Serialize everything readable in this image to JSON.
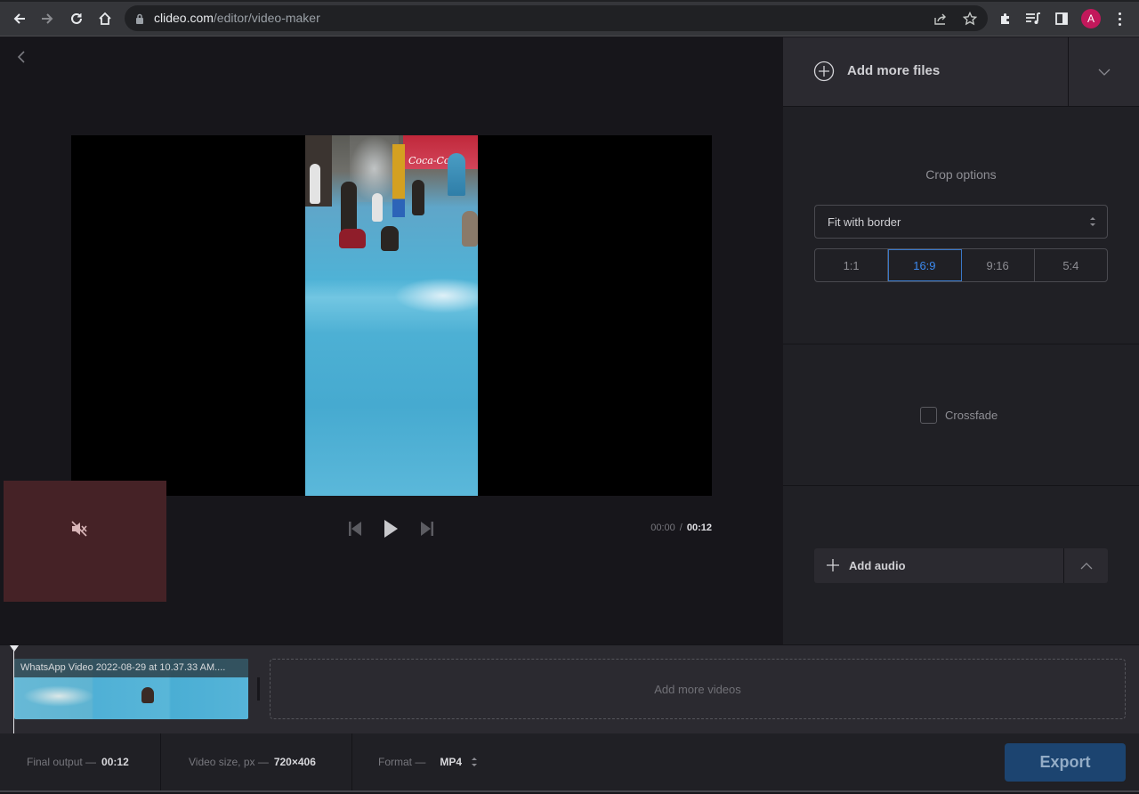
{
  "browser": {
    "url_host": "clideo.com",
    "url_path": "/editor/video-maker",
    "avatar_initial": "A",
    "icons": [
      "back-arrow-icon",
      "forward-arrow-icon",
      "reload-icon",
      "home-icon",
      "lock-icon",
      "share-icon",
      "star-icon",
      "extensions-icon",
      "media-control-icon",
      "side-panel-icon",
      "profile-avatar",
      "kebab-menu-icon"
    ]
  },
  "editor": {
    "back_icon": "chevron-left-icon",
    "player": {
      "current_time": "00:00",
      "separator": "/",
      "total_time": "00:12",
      "muted": true
    }
  },
  "side_panel": {
    "add_files_label": "Add more files",
    "crop": {
      "title": "Crop options",
      "mode": "Fit with border",
      "ratios": [
        {
          "label": "1:1",
          "active": false
        },
        {
          "label": "16:9",
          "active": true
        },
        {
          "label": "9:16",
          "active": false
        },
        {
          "label": "5:4",
          "active": false
        }
      ]
    },
    "crossfade": {
      "label": "Crossfade",
      "checked": false
    },
    "audio": {
      "label": "Add audio"
    }
  },
  "timeline": {
    "clip_title": "WhatsApp Video 2022-08-29 at 10.37.33 AM....",
    "dropzone_label": "Add more videos"
  },
  "footer": {
    "final_output_label": "Final output —",
    "final_output_value": "00:12",
    "video_size_label": "Video size, px —",
    "video_size_value": "720×406",
    "format_label": "Format —",
    "format_value": "MP4",
    "export_label": "Export"
  },
  "colors": {
    "accent_blue": "#3c8af0",
    "export_bg": "#1c4470",
    "avatar": "#c2185b"
  }
}
